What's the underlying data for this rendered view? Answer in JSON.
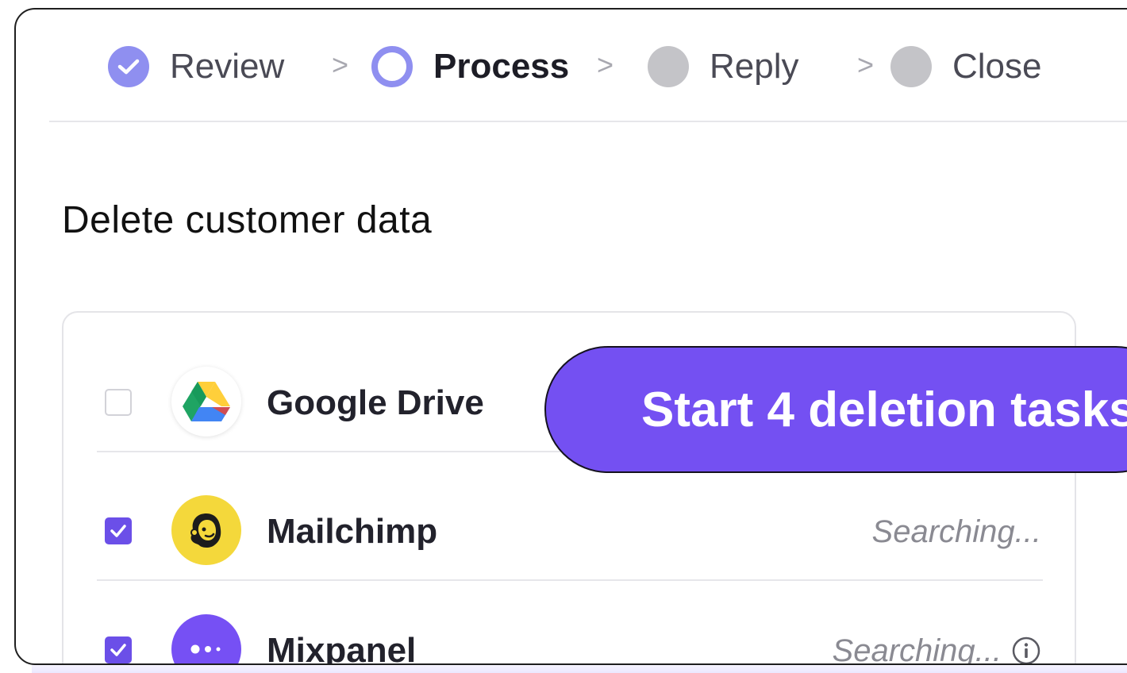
{
  "stepper": {
    "steps": [
      {
        "label": "Review",
        "state": "done"
      },
      {
        "label": "Process",
        "state": "active"
      },
      {
        "label": "Reply",
        "state": "todo"
      },
      {
        "label": "Close",
        "state": "todo"
      }
    ],
    "separator": ">"
  },
  "section": {
    "title": "Delete customer data"
  },
  "integrations": [
    {
      "name": "Google Drive",
      "checked": false,
      "status": "",
      "icon": "google-drive-logo"
    },
    {
      "name": "Mailchimp",
      "checked": true,
      "status": "Searching...",
      "icon": "mailchimp-logo"
    },
    {
      "name": "Mixpanel",
      "checked": true,
      "status": "Searching...",
      "icon": "mixpanel-logo",
      "info": true
    }
  ],
  "action": {
    "start_label": "Start 4 deletion tasks"
  },
  "colors": {
    "accent": "#7450f2",
    "step_done": "#8f8ff0",
    "step_todo": "#c4c4c8",
    "mailchimp_yellow": "#f4d83b"
  }
}
